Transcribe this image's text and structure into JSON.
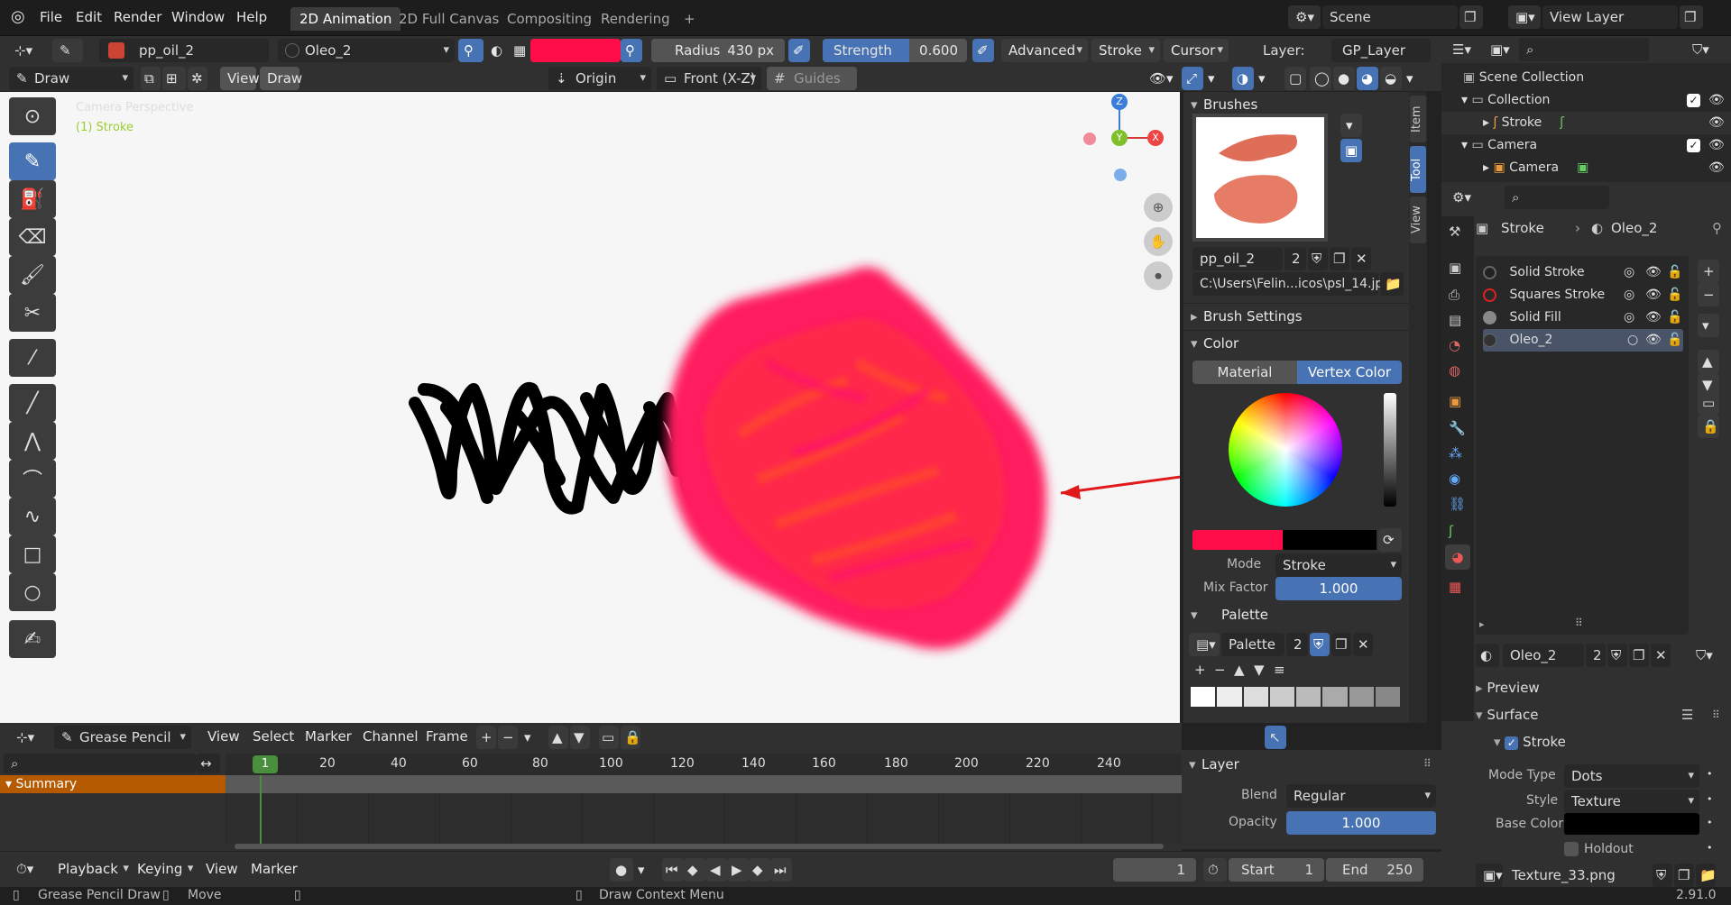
{
  "menubar": {
    "items": [
      "File",
      "Edit",
      "Render",
      "Window",
      "Help"
    ],
    "workspaces": [
      "2D Animation",
      "2D Full Canvas",
      "Compositing",
      "Rendering"
    ],
    "active_workspace": "2D Animation",
    "add_tab": "+",
    "scene": "Scene",
    "view_layer": "View Layer"
  },
  "tool_header": {
    "brush_name": "pp_oil_2",
    "material": "Oleo_2",
    "color_hex": "#ff0d48",
    "radius_label": "Radius",
    "radius_value": "430 px",
    "strength_label": "Strength",
    "strength_value": "0.600",
    "advanced": "Advanced",
    "stroke": "Stroke",
    "cursor": "Cursor",
    "layer_label": "Layer:",
    "layer_value": "GP_Layer"
  },
  "mode_header": {
    "mode": "Draw",
    "view_btn": "View",
    "draw_btn": "Draw",
    "origin": "Origin",
    "plane": "Front (X-Z)",
    "guides": "Guides"
  },
  "viewport": {
    "camera_text": "Camera Perspective",
    "object_text": "(1) Stroke",
    "gizmo_z": "Z",
    "gizmo_y": "Y",
    "gizmo_x": "X"
  },
  "npanel": {
    "tabs": [
      "Item",
      "Tool",
      "View"
    ],
    "active_tab": "Tool",
    "brushes_title": "Brushes",
    "brush_name": "pp_oil_2",
    "brush_users": "2",
    "brush_path": "C:\\Users\\Felin...icos\\psl_14.jpg",
    "brush_settings_title": "Brush Settings",
    "color_title": "Color",
    "color_tabs": [
      "Material",
      "Vertex Color"
    ],
    "active_color_tab": "Vertex Color",
    "mode_label": "Mode",
    "mode_value": "Stroke",
    "mix_label": "Mix Factor",
    "mix_value": "1.000",
    "palette_title": "Palette",
    "palette_name": "Palette",
    "palette_users": "2"
  },
  "outliner": {
    "rows": [
      {
        "label": "Scene Collection"
      },
      {
        "label": "Collection"
      },
      {
        "label": "Stroke"
      },
      {
        "label": "Camera"
      },
      {
        "label": "Camera"
      }
    ]
  },
  "properties": {
    "object": "Stroke",
    "material": "Oleo_2",
    "slots": [
      "Solid Stroke",
      "Squares Stroke",
      "Solid Fill",
      "Oleo_2"
    ],
    "active_slot": "Oleo_2",
    "material_name": "Oleo_2",
    "material_users": "2",
    "preview": "Preview",
    "surface": "Surface",
    "stroke_check": "Stroke",
    "mode_type_label": "Mode Type",
    "mode_type_value": "Dots",
    "style_label": "Style",
    "style_value": "Texture",
    "base_color_label": "Base Color",
    "holdout": "Holdout",
    "texture": "Texture_33.png"
  },
  "timeline": {
    "editor": "Grease Pencil",
    "menus": [
      "View",
      "Select",
      "Marker",
      "Channel",
      "Frame"
    ],
    "ticks": [
      "1",
      "20",
      "40",
      "60",
      "80",
      "100",
      "120",
      "140",
      "160",
      "180",
      "200",
      "220",
      "240"
    ],
    "summary": "Summary"
  },
  "layer_panel": {
    "title": "Layer",
    "blend_label": "Blend",
    "blend_value": "Regular",
    "opacity_label": "Opacity",
    "opacity_value": "1.000"
  },
  "playbar": {
    "menus": [
      "Playback",
      "Keying",
      "View",
      "Marker"
    ],
    "current_frame": "1",
    "start_label": "Start",
    "start_value": "1",
    "end_label": "End",
    "end_value": "250"
  },
  "statusbar": {
    "left": "Grease Pencil Draw",
    "move": "Move",
    "context": "Draw Context Menu",
    "version": "2.91.0"
  }
}
